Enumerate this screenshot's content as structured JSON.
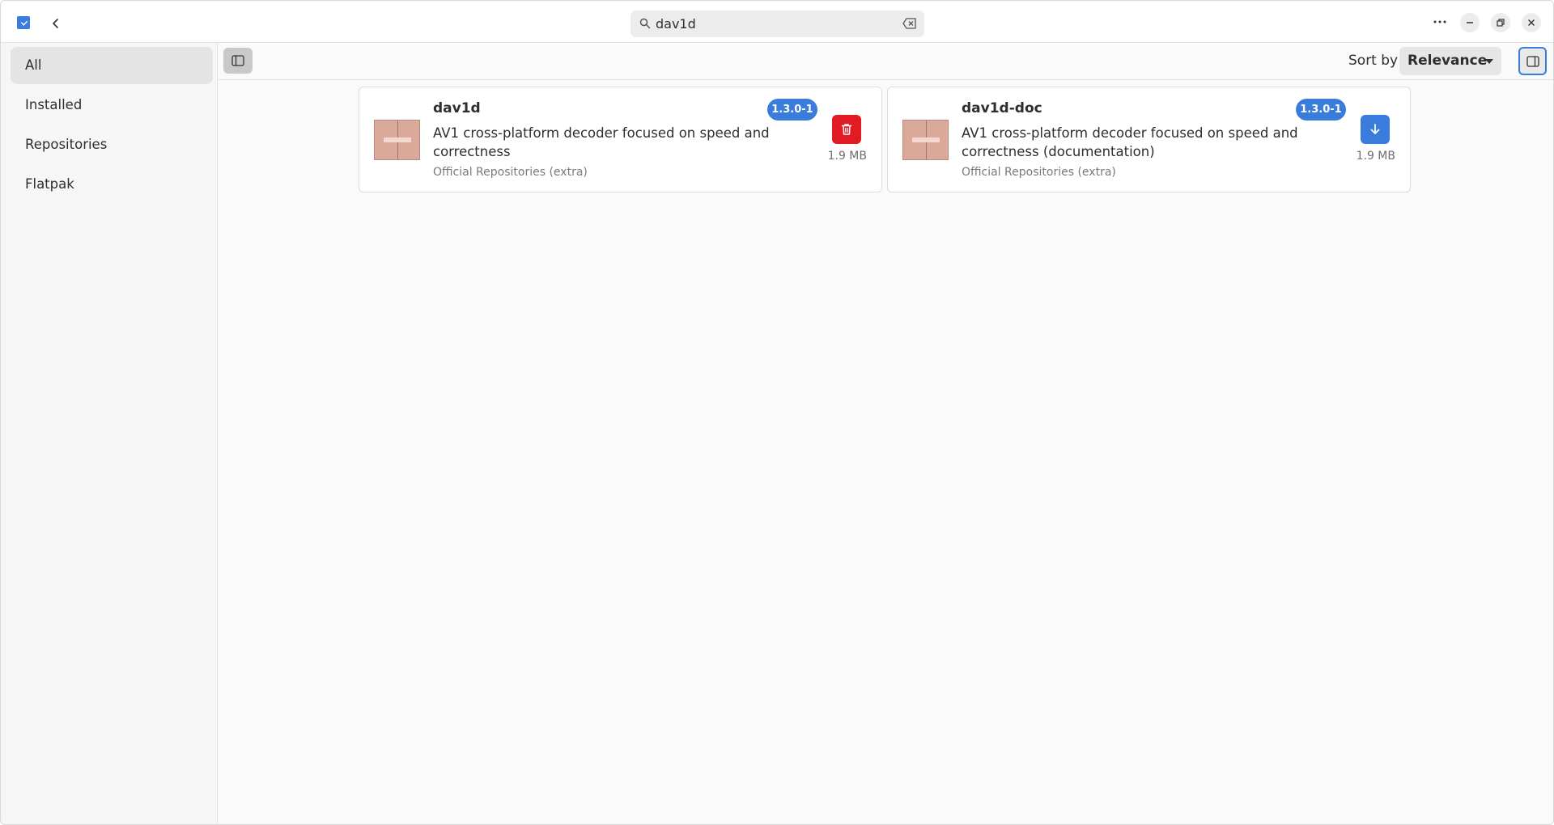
{
  "header": {
    "search_value": "dav1d",
    "search_placeholder": ""
  },
  "sidebar": {
    "items": [
      {
        "label": "All",
        "active": true
      },
      {
        "label": "Installed",
        "active": false
      },
      {
        "label": "Repositories",
        "active": false
      },
      {
        "label": "Flatpak",
        "active": false
      }
    ]
  },
  "toolbar": {
    "sort_label": "Sort by",
    "sort_value": "Relevance"
  },
  "results": [
    {
      "name": "dav1d",
      "description": "AV1 cross-platform decoder focused on speed and correctness",
      "repository": "Official Repositories (extra)",
      "version": "1.3.0-1",
      "size": "1.9 MB",
      "action": "remove",
      "action_icon": "trash-icon",
      "action_color": "#e01b24"
    },
    {
      "name": "dav1d-doc",
      "description": "AV1 cross-platform decoder focused on speed and correctness (documentation)",
      "repository": "Official Repositories (extra)",
      "version": "1.3.0-1",
      "size": "1.9 MB",
      "action": "install",
      "action_icon": "download-arrow-icon",
      "action_color": "#3a7cdb"
    }
  ],
  "colors": {
    "accent": "#3a7cdb",
    "danger": "#e01b24"
  }
}
